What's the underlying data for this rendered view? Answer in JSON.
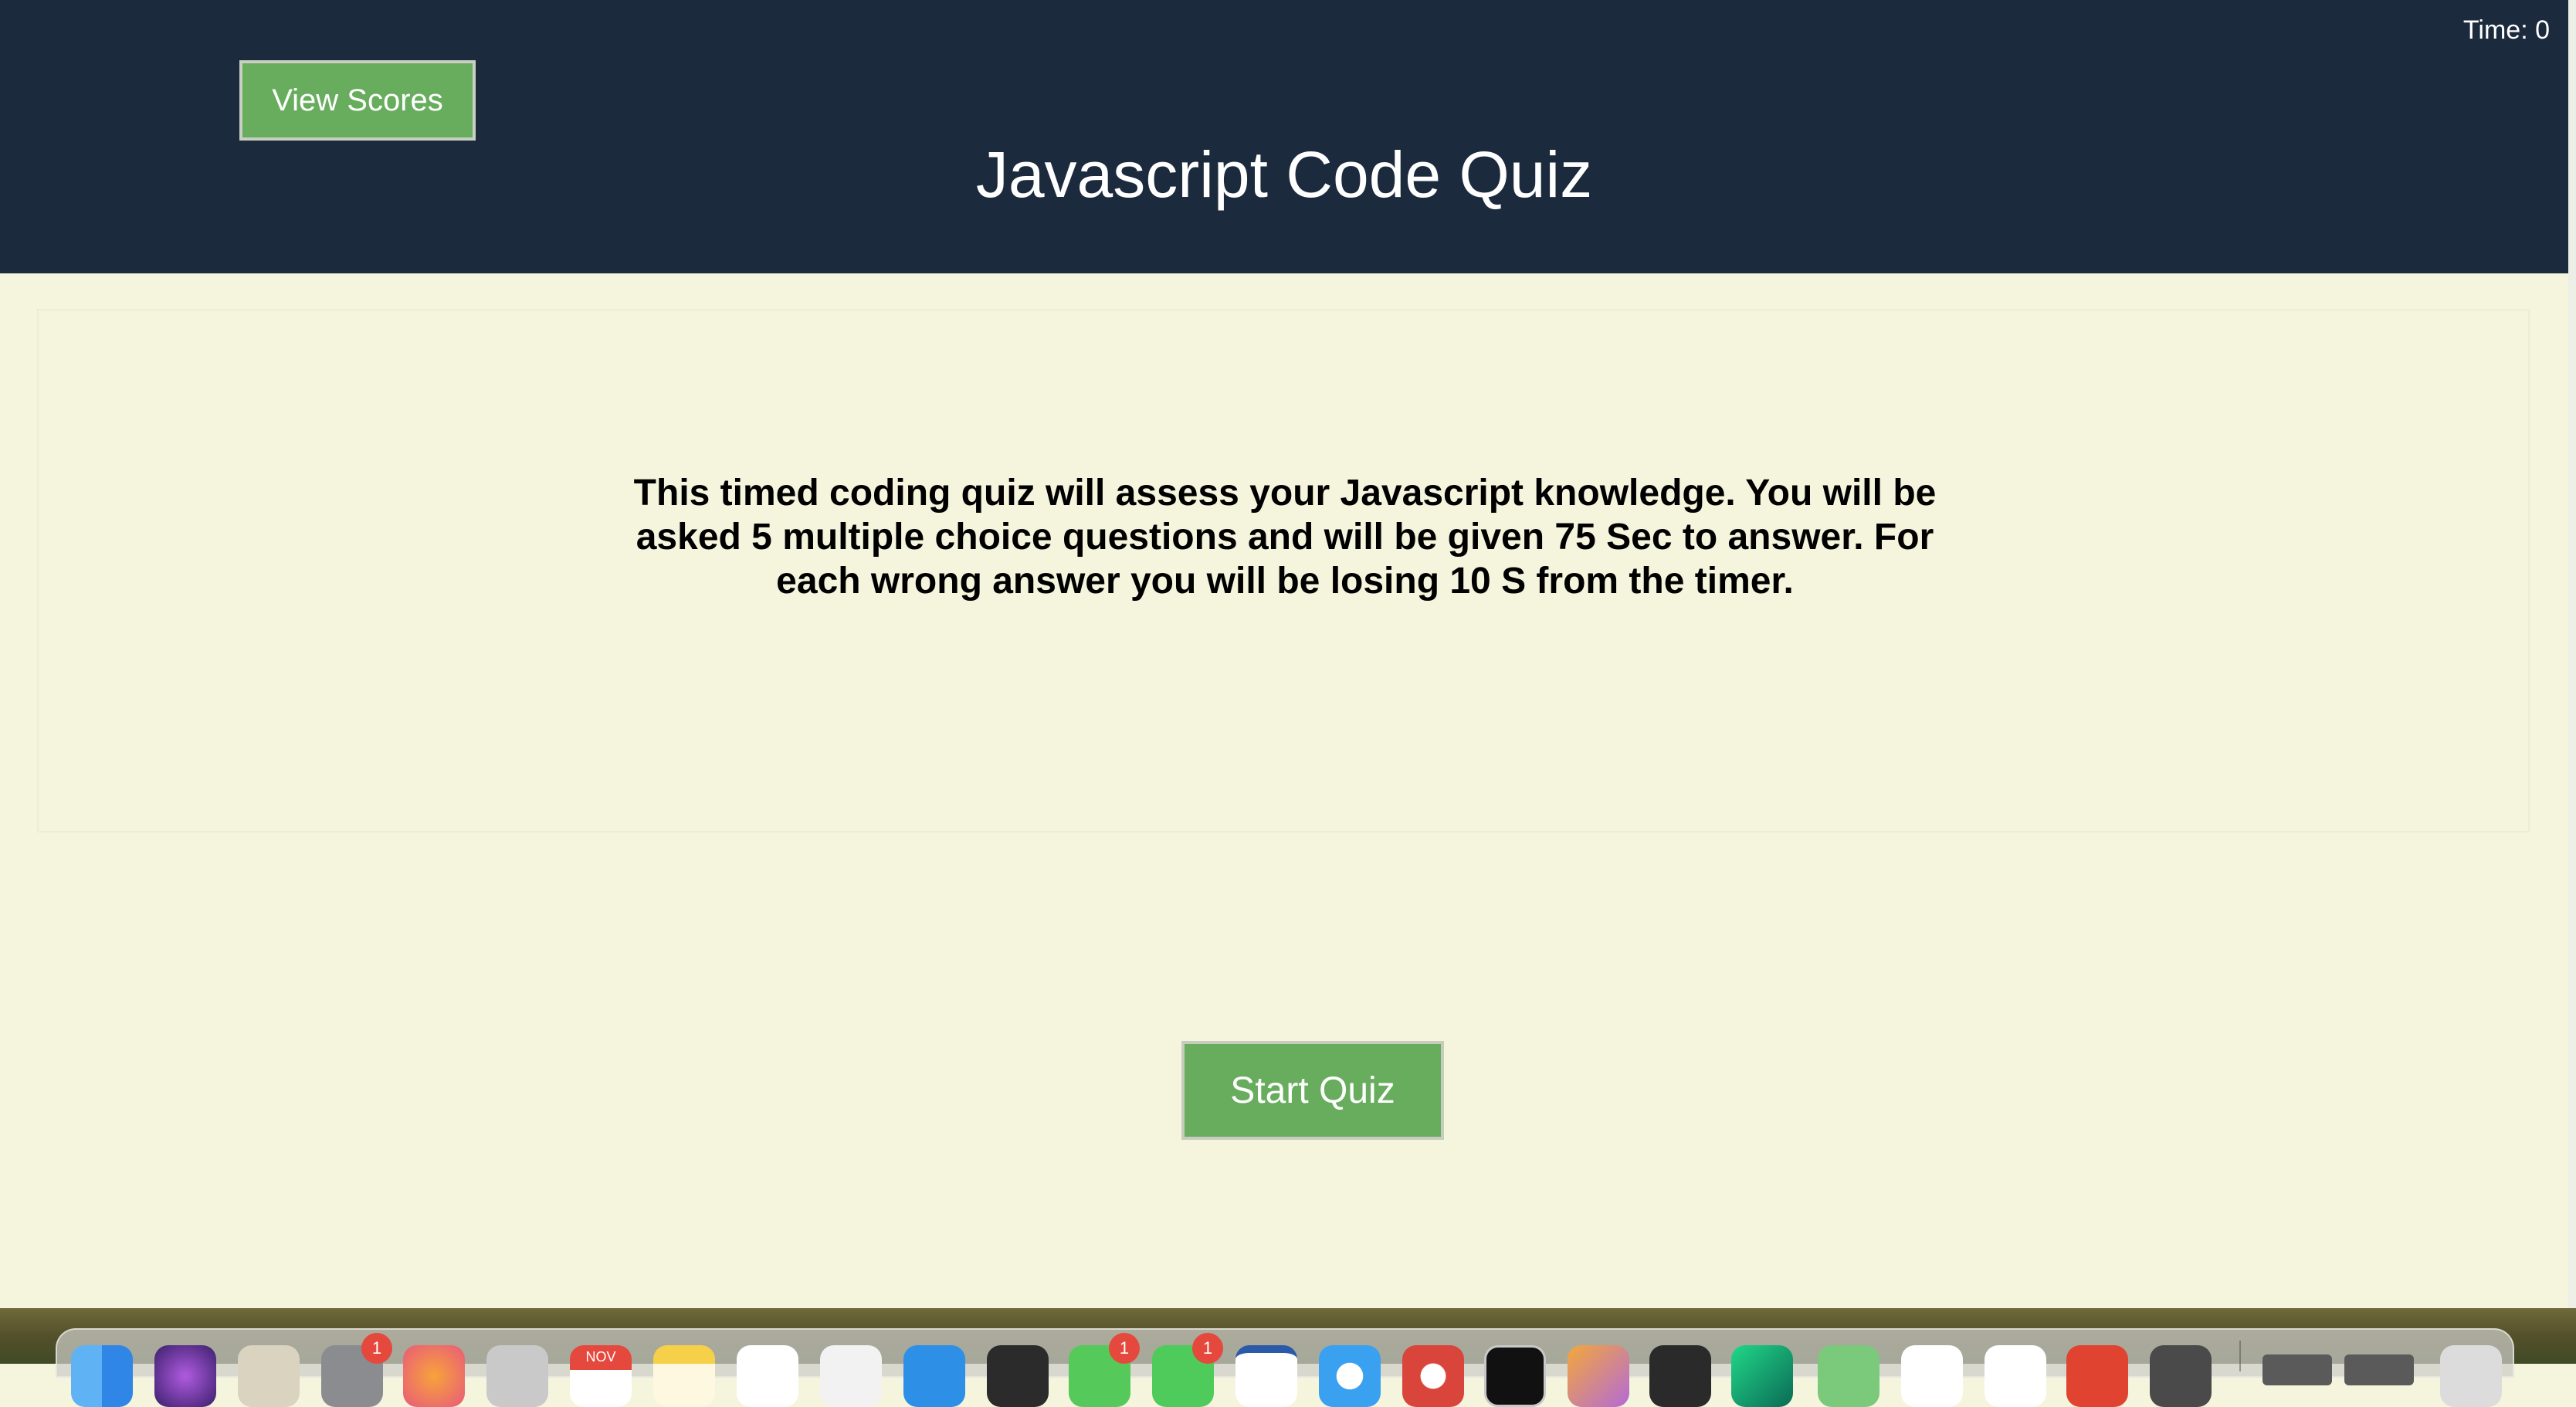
{
  "header": {
    "timer_label": "Time: 0",
    "title": "Javascript Code Quiz",
    "view_scores_label": "View Scores"
  },
  "main": {
    "instructions_lines": [
      "This timed coding quiz will assess your Javascript knowledge. You will be",
      "asked 5 multiple choice questions and will be given 75 Sec to answer. For",
      "each wrong answer you will be losing 10 S from the timer."
    ],
    "start_quiz_label": "Start Quiz"
  },
  "dock": {
    "calendar_month": "NOV",
    "badges": [
      "1",
      "1",
      "1"
    ],
    "apps": [
      "finder-icon",
      "siri-icon",
      "launchpad-icon",
      "system-settings-icon",
      "photos-icon",
      "preview-icon",
      "calendar-icon",
      "notes-icon",
      "reminders-icon",
      "freeform-icon",
      "app-store-icon",
      "terminal-icon",
      "messages-icon",
      "facetime-icon",
      "word-icon",
      "safari-icon",
      "chrome-icon",
      "iterm-icon",
      "paint-icon",
      "console-icon",
      "pycharm-icon",
      "money-icon",
      "slack-icon",
      "vscode-icon",
      "brave-icon",
      "sublime-icon",
      "trash-icon"
    ]
  },
  "colors": {
    "header_bg": "#1b2a3d",
    "page_bg": "#f5f5dd",
    "button_green": "#68ad5e"
  }
}
